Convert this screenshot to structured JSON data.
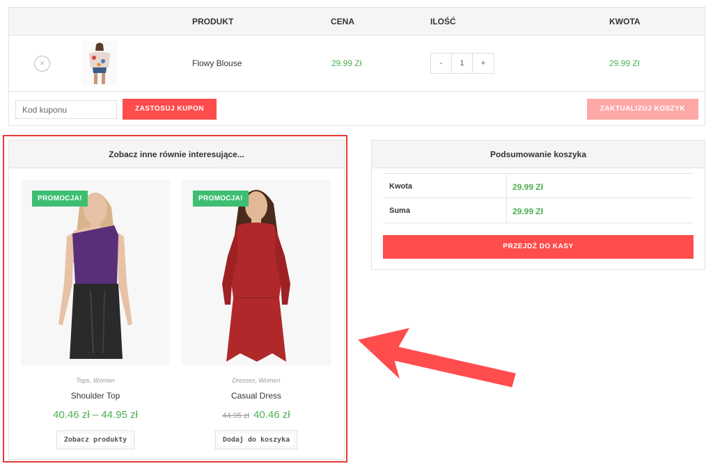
{
  "cart": {
    "headers": {
      "product": "PRODUKT",
      "price": "CENA",
      "quantity": "ILOŚĆ",
      "total": "KWOTA"
    },
    "items": [
      {
        "remove_icon": "×",
        "name": "Flowy Blouse",
        "price": "29.99 Zł",
        "qty_minus": "-",
        "qty": "1",
        "qty_plus": "+",
        "total": "29.99 Zł"
      }
    ],
    "coupon_placeholder": "Kod kuponu",
    "apply_coupon": "ZASTOSUJ KUPON",
    "update_cart": "ZAKTUALIZUJ KOSZYK"
  },
  "cross_sells": {
    "title": "Zobacz inne równie interesujące...",
    "products": [
      {
        "badge": "PROMOCJA!",
        "categories": "Tops, Women",
        "name": "Shoulder Top",
        "price": "40.46 zł – 44.95 zł",
        "old_price": "",
        "button": "Zobacz produkty"
      },
      {
        "badge": "PROMOCJA!",
        "categories": "Dresses, Women",
        "name": "Casual Dress",
        "price": "40.46 zł",
        "old_price": "44.95 zł",
        "button": "Dodaj do koszyka"
      }
    ]
  },
  "totals": {
    "title": "Podsumowanie koszyka",
    "subtotal_label": "Kwota",
    "subtotal_value": "29.99 Zł",
    "total_label": "Suma",
    "total_value": "29.99 Zł",
    "checkout": "PRZEJDŹ DO KASY"
  },
  "colors": {
    "accent": "#ff4c4c",
    "price": "#4caf50",
    "badge": "#3dbf72",
    "annotation": "#e53935"
  }
}
